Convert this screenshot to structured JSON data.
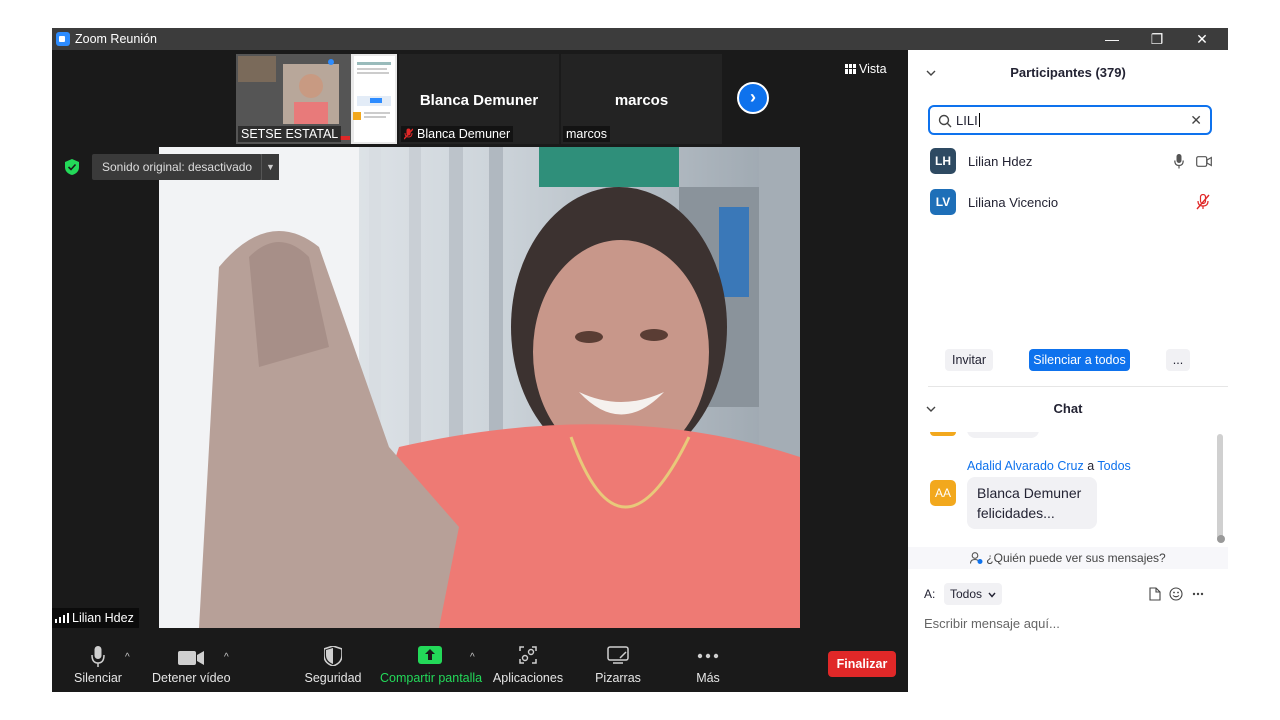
{
  "window": {
    "title": "Zoom Reunión",
    "minimize": "—",
    "restore": "❐",
    "close": "✕"
  },
  "thumbnails": [
    {
      "label": "SETSE ESTATAL",
      "name": ""
    },
    {
      "label": "Blanca Demuner",
      "name": "Blanca Demuner"
    },
    {
      "label": "marcos",
      "name": "marcos"
    }
  ],
  "view_button": "Vista",
  "original_sound": "Sonido original: desactivado",
  "active_speaker": "Lilian Hdez",
  "toolbar": {
    "mute": "Silenciar",
    "stop_video": "Detener vídeo",
    "security": "Seguridad",
    "share_screen": "Compartir pantalla",
    "apps": "Aplicaciones",
    "whiteboards": "Pizarras",
    "more": "Más",
    "end": "Finalizar"
  },
  "participants": {
    "title": "Participantes (379)",
    "search_value": "LILI",
    "list": [
      {
        "initials": "LH",
        "name": "Lilian Hdez",
        "color": "#2e4a62"
      },
      {
        "initials": "LV",
        "name": "Liliana Vicencio",
        "color": "#1e6fb8"
      }
    ],
    "invite": "Invitar",
    "mute_all": "Silenciar a todos",
    "more": "..."
  },
  "chat": {
    "title": "Chat",
    "message": {
      "initials": "AA",
      "sender": "Adalid Alvarado Cruz",
      "connector": "a",
      "recipient": "Todos",
      "text_line1": "Blanca Demuner",
      "text_line2": "felicidades..."
    },
    "who_can_see": "¿Quién puede ver sus mensajes?",
    "to_label": "A:",
    "to_value": "Todos",
    "input_placeholder": "Escribir mensaje aquí..."
  },
  "colors": {
    "accent": "#0e72ed",
    "end": "#e02828",
    "share": "#23d959",
    "avatar_aa": "#f2a81d"
  }
}
